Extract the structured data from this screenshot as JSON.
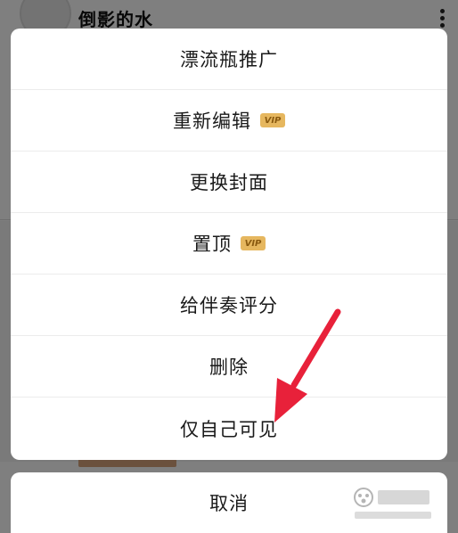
{
  "background": {
    "title": "倒影的水",
    "more_icon": "more-vertical-icon"
  },
  "sheet": {
    "items": [
      {
        "label": "漂流瓶推广",
        "vip": false
      },
      {
        "label": "重新编辑",
        "vip": true
      },
      {
        "label": "更换封面",
        "vip": false
      },
      {
        "label": "置顶",
        "vip": true
      },
      {
        "label": "给伴奏评分",
        "vip": false
      },
      {
        "label": "删除",
        "vip": false
      },
      {
        "label": "仅自己可见",
        "vip": false
      }
    ],
    "vip_label": "VIP",
    "cancel_label": "取消"
  },
  "colors": {
    "vip_badge": "#e6b75f",
    "arrow": "#e8213a",
    "overlay": "rgba(0,0,0,0.5)"
  }
}
